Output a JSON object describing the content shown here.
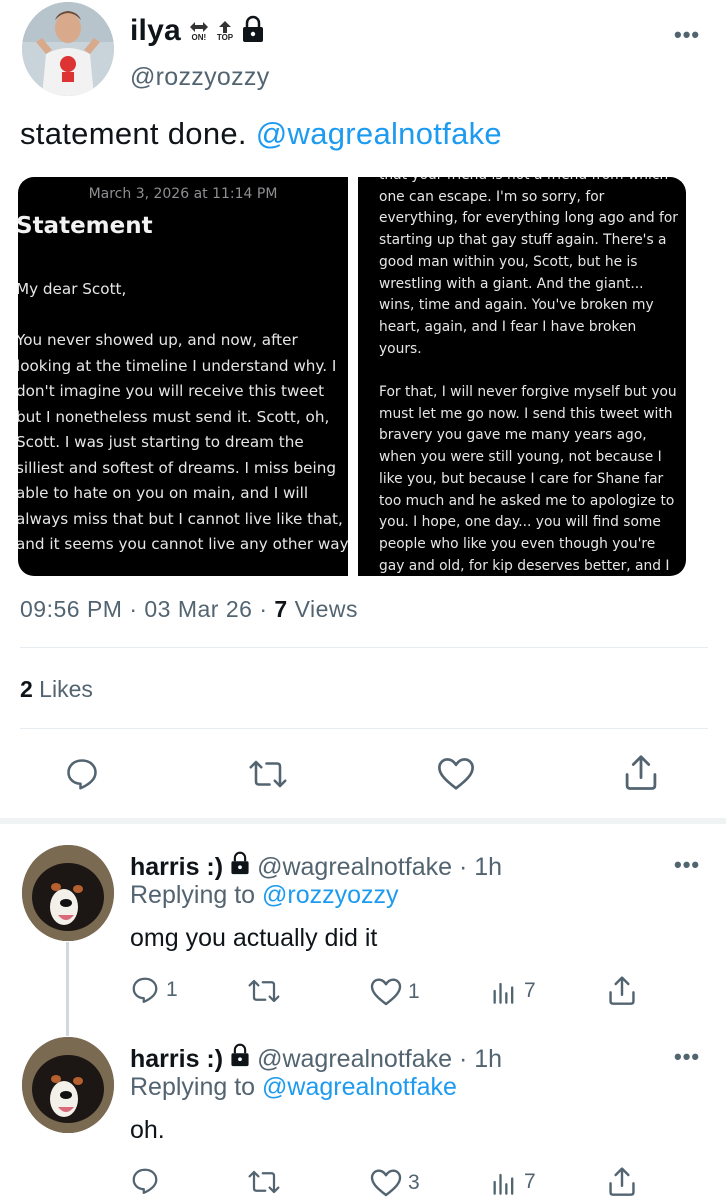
{
  "tweet": {
    "display_name": "ilya",
    "badge1": "ON!",
    "badge2": "TOP",
    "handle": "@rozzyozzy",
    "text": "statement done.",
    "mention": "@wagrealnotfake",
    "time": "09:56 PM · 03 Mar 26 · ",
    "views_count": "7",
    "views_label": " Views",
    "likes_count": "2",
    "likes_label": " Likes"
  },
  "statement": {
    "date": "March 3, 2026 at 11:14 PM",
    "title": "Statement",
    "left_text": "My dear Scott,\n\nYou never showed up, and now, after looking at the timeline I understand why. I don't imagine you will receive this tweet but I nonetheless must send it. Scott, oh, Scott. I was just starting to dream the silliest and softest of dreams. I miss being able to hate on you on main, and I will always miss that but I cannot live like that, and it seems you cannot live any other way.",
    "right_text": "that your friend is not a friend from which one can escape. I'm so sorry, for everything, for everything long ago and for starting up that gay stuff again. There's a good man within you, Scott, but he is wrestling with a giant. And the giant... wins, time and again. You've broken my heart, again, and I fear I have broken yours.\n\nFor that, I will never forgive myself but you must let me go now. I send this tweet with bravery you gave me many years ago, when you were still young, not because I like you, but because I care for Shane far too much and he asked me to apologize to you. I hope, one day... you will find some people who like you even though you're gay and old, for kip deserves better, and I hope by writing this statement, I can finally be free."
  },
  "replies": [
    {
      "name": "harris :)",
      "handle": "@wagrealnotfake · 1h",
      "replying_label": "Replying to ",
      "replying_to": "@rozzyozzy",
      "text": "omg you actually did it",
      "reply_count": "1",
      "like_count": "1",
      "view_count": "7"
    },
    {
      "name": "harris :)",
      "handle": "@wagrealnotfake · 1h",
      "replying_label": "Replying to ",
      "replying_to": "@wagrealnotfake",
      "text": "oh.",
      "reply_count": "",
      "like_count": "3",
      "view_count": "7"
    }
  ],
  "more_glyph": "•••",
  "colors": {
    "accent": "#1d9bf0",
    "secondary": "#536471"
  }
}
